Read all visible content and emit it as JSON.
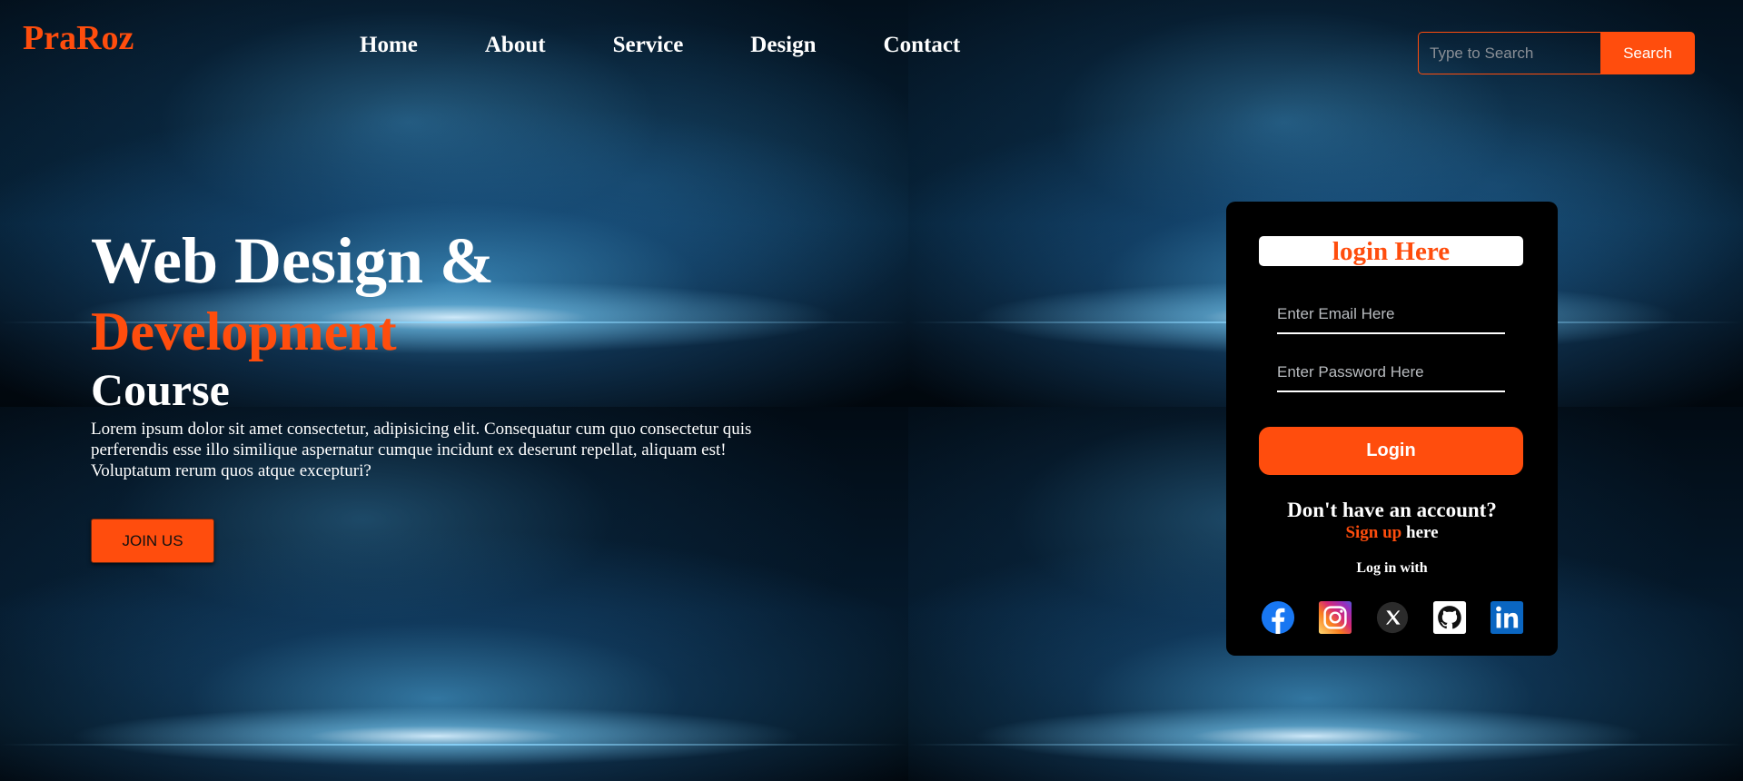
{
  "brand": {
    "logo": "PraRoz"
  },
  "nav": {
    "items": [
      "Home",
      "About",
      "Service",
      "Design",
      "Contact"
    ]
  },
  "search": {
    "placeholder": "Type to Search",
    "button_label": "Search"
  },
  "hero": {
    "title_line1": "Web Design &",
    "title_accent": "Development",
    "title_line3": "Course",
    "description": "Lorem ipsum dolor sit amet consectetur, adipisicing elit. Consequatur cum quo consectetur quis perferendis esse illo similique aspernatur cumque incidunt ex deserunt repellat, aliquam est! Voluptatum rerum quos atque excepturi?",
    "join_label": "JOIN US"
  },
  "login": {
    "title": "login Here",
    "email_placeholder": "Enter Email Here",
    "password_placeholder": "Enter Password Here",
    "login_label": "Login",
    "no_account": "Don't have an account?",
    "signup_link": "Sign up",
    "signup_suffix": " here",
    "login_with": "Log in with",
    "socials": [
      "facebook",
      "instagram",
      "x",
      "github",
      "linkedin"
    ]
  },
  "colors": {
    "accent": "#ff4d0d",
    "card_bg": "#000000",
    "text": "#ffffff"
  }
}
